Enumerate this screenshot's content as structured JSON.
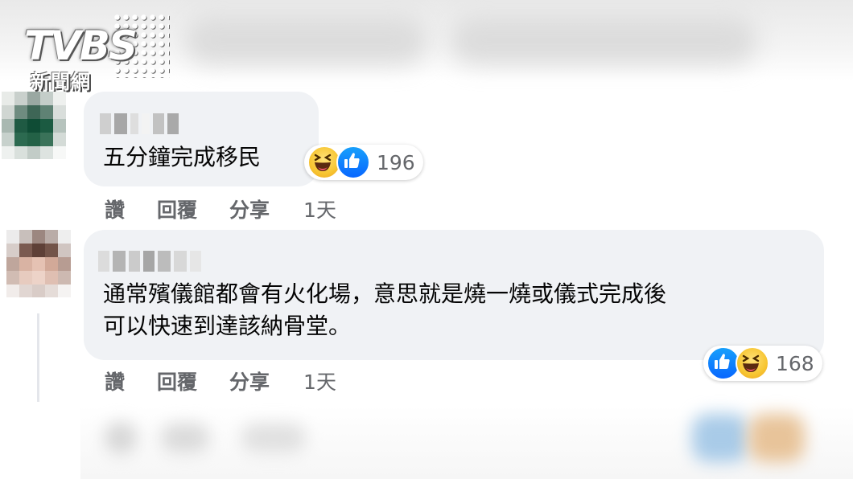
{
  "watermark": {
    "brand": "TVBS",
    "subtitle": "新聞網"
  },
  "comments": [
    {
      "text": "五分鐘完成移民",
      "reactions": {
        "icons": [
          "haha-icon",
          "like-icon"
        ],
        "count": "196"
      },
      "actions": {
        "like": "讚",
        "reply": "回覆",
        "share": "分享",
        "time": "1天"
      }
    },
    {
      "text": "通常殯儀館都會有火化場，意思就是燒一燒或儀式完成後\n可以快速到達該納骨堂。",
      "reactions": {
        "icons": [
          "like-icon",
          "haha-icon"
        ],
        "count": "168"
      },
      "actions": {
        "like": "讚",
        "reply": "回覆",
        "share": "分享",
        "time": "1天"
      }
    }
  ],
  "colors": {
    "bubble": "#f0f2f5",
    "action_text": "#65676b",
    "like_blue": "#0866ff",
    "haha_yellow": "#f7c531"
  }
}
